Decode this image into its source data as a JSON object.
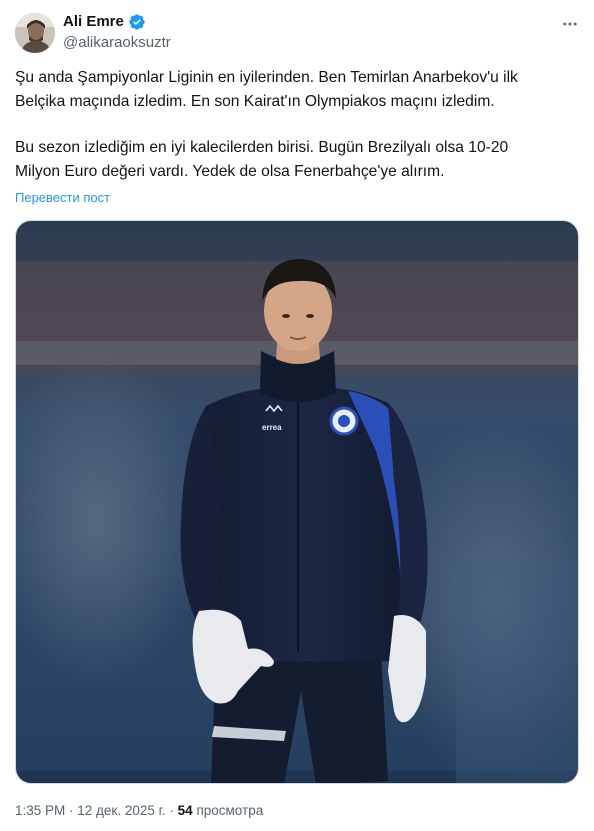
{
  "author": {
    "display_name": "Ali Emre",
    "handle": "@alikaraoksuztr",
    "verified_icon": "verified-badge-icon",
    "accent_color": "#1d9bf0"
  },
  "tweet": {
    "paragraph1_line1": "Şu anda Şampiyonlar Liginin en iyilerinden. Ben Temirlan Anarbekov'u ilk",
    "paragraph1_line2": "Belçika maçında izledim. En son Kairat'ın Olympiakos maçını izledim.",
    "paragraph2_line1": "Bu sezon izlediğim en iyi kalecilerden birisi. Bugün Brezilyalı olsa 10-20",
    "paragraph2_line2": "Milyon Euro değeri vardı. Yedek de olsa Fenerbahçe'ye alırım.",
    "translate_label": "Перевести пост"
  },
  "media": {
    "jersey_logo_text": "errea"
  },
  "meta": {
    "time": "1:35 PM",
    "separator": " · ",
    "date": "12 дек. 2025 г.",
    "separator2": " · ",
    "views_count": "54",
    "views_label": " просмотра"
  },
  "icons": {
    "more": "more-options-icon"
  }
}
